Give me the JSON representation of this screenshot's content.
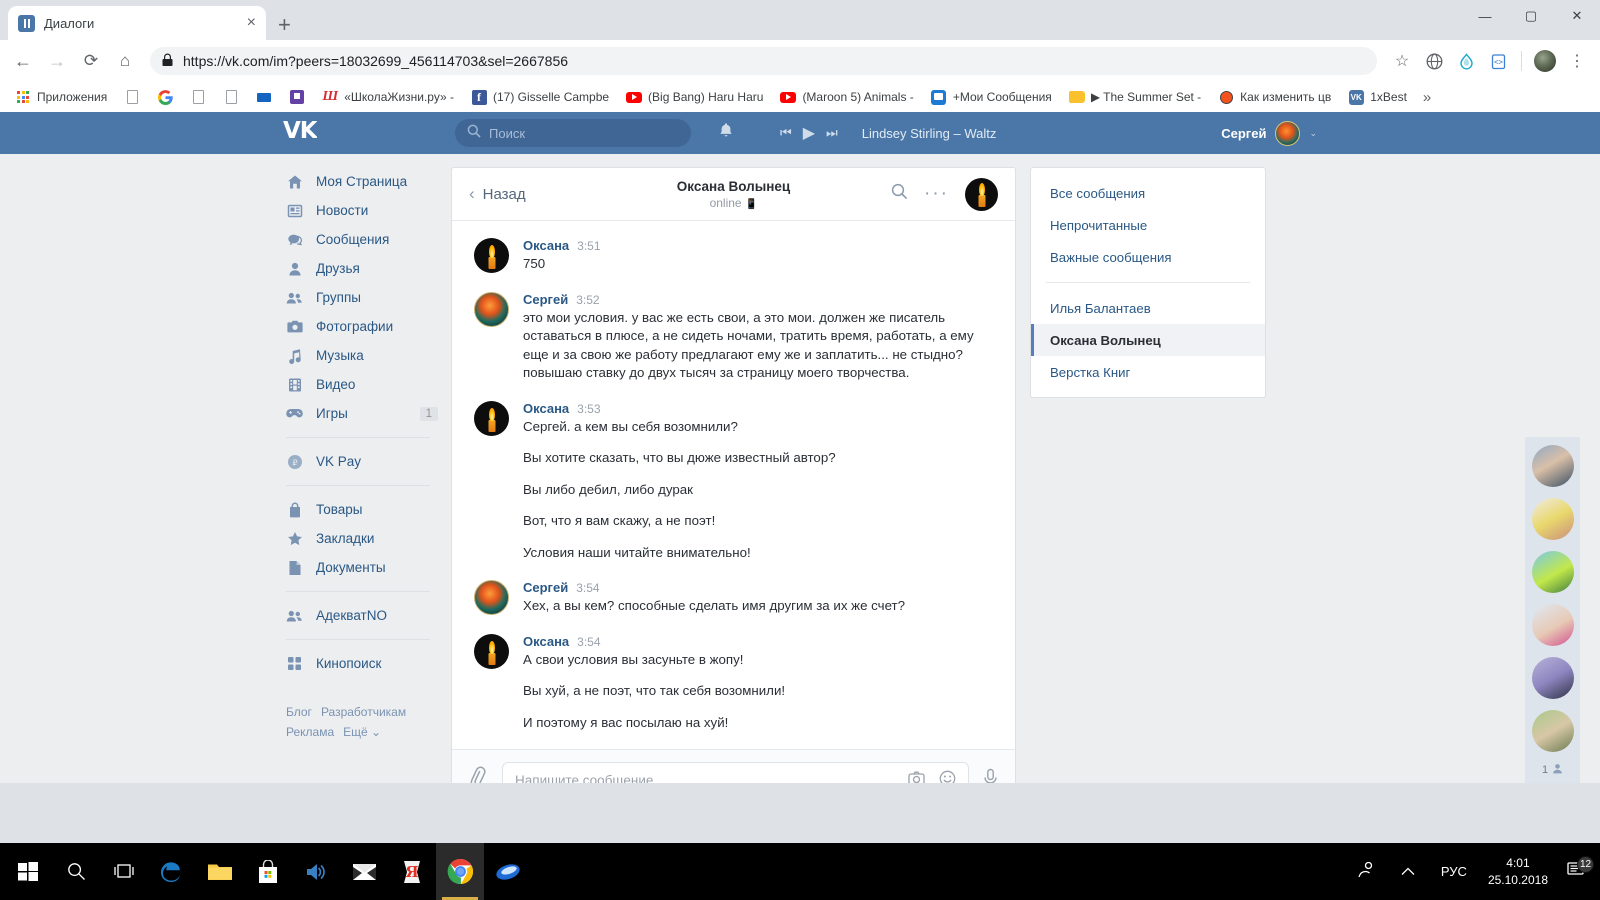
{
  "browser": {
    "tab": {
      "title": "Диалоги",
      "favicon": "vk-favicon",
      "close": "×"
    },
    "newtab_label": "+",
    "window_controls": {
      "minimize": "—",
      "maximize": "▢",
      "close": "✕"
    },
    "nav": {
      "back": "←",
      "forward": "→",
      "reload": "⟳",
      "home": "⌂"
    },
    "omnibox": {
      "lock": "🔒",
      "url": "https://vk.com/im?peers=18032699_456114703&sel=2667856",
      "star": "☆"
    },
    "toolbar_icons": [
      "globe-icon",
      "droplet-icon",
      "code-script-icon",
      "browser-profile-avatar",
      "chrome-menu-icon"
    ],
    "bookmarks": [
      {
        "label": "Приложения",
        "icon": "apps-grid-icon"
      },
      {
        "label": "",
        "icon": "doc-icon"
      },
      {
        "label": "",
        "icon": "google-icon"
      },
      {
        "label": "",
        "icon": "doc-icon"
      },
      {
        "label": "",
        "icon": "doc-icon"
      },
      {
        "label": "",
        "icon": "bars-icon"
      },
      {
        "label": "",
        "icon": "twitch-icon"
      },
      {
        "label": "«ШколаЖизни.ру» -",
        "icon": "shkola-icon"
      },
      {
        "label": "(17) Gisselle Campbe",
        "icon": "facebook-icon"
      },
      {
        "label": "(Big Bang) Haru Haru",
        "icon": "youtube-icon"
      },
      {
        "label": "(Maroon 5) Animals -",
        "icon": "youtube-icon"
      },
      {
        "label": "+Мои Сообщения",
        "icon": "messages-icon"
      },
      {
        "label": "▶ The Summer Set -",
        "icon": "folder-icon"
      },
      {
        "label": "Как изменить цв",
        "icon": "orange-circle-icon"
      },
      {
        "label": "1xBest",
        "icon": "vk-icon"
      }
    ],
    "bookmarks_overflow": "»"
  },
  "vk": {
    "logo": "VK",
    "search": {
      "placeholder": "Поиск",
      "icon": "search-icon"
    },
    "notifications_icon": "bell-icon",
    "player": {
      "prev": "⏮",
      "play": "▶",
      "next": "⏭",
      "track": "Lindsey Stirling – Waltz"
    },
    "user": {
      "name": "Сергей",
      "caret": "⌄"
    },
    "sidebar": {
      "items": [
        {
          "label": "Моя Страница",
          "icon": "home-icon",
          "badge": ""
        },
        {
          "label": "Новости",
          "icon": "news-icon",
          "badge": ""
        },
        {
          "label": "Сообщения",
          "icon": "messages-icon",
          "badge": ""
        },
        {
          "label": "Друзья",
          "icon": "friend-icon",
          "badge": ""
        },
        {
          "label": "Группы",
          "icon": "groups-icon",
          "badge": ""
        },
        {
          "label": "Фотографии",
          "icon": "camera-icon",
          "badge": ""
        },
        {
          "label": "Музыка",
          "icon": "music-note-icon",
          "badge": ""
        },
        {
          "label": "Видео",
          "icon": "film-icon",
          "badge": ""
        },
        {
          "label": "Игры",
          "icon": "gamepad-icon",
          "badge": "1"
        }
      ],
      "items2": [
        {
          "label": "VK Pay",
          "icon": "vkpay-icon"
        }
      ],
      "items3": [
        {
          "label": "Товары",
          "icon": "bag-icon"
        },
        {
          "label": "Закладки",
          "icon": "star-icon"
        },
        {
          "label": "Документы",
          "icon": "document-icon"
        }
      ],
      "items4": [
        {
          "label": "АдекватNO",
          "icon": "groups-icon"
        }
      ],
      "items5": [
        {
          "label": "Кинопоиск",
          "icon": "grid-icon"
        }
      ],
      "footer": [
        "Блог",
        "Разработчикам",
        "Реклама",
        "Ещё ⌄"
      ]
    },
    "chat": {
      "back_label": "Назад",
      "back_icon": "chevron-left-icon",
      "title": "Оксана Волынец",
      "status": "online",
      "status_device_icon": "mobile-icon",
      "search_icon": "search-icon",
      "more_icon": "ellipsis-icon",
      "avatar": "candle-avatar",
      "messages": [
        {
          "author": "Оксана",
          "time": "3:51",
          "avatar": "candle-avatar",
          "lines": [
            "750"
          ]
        },
        {
          "author": "Сергей",
          "time": "3:52",
          "avatar": "sergey-avatar",
          "lines": [
            "это мои условия. у вас же есть свои, а это мои. должен же писатель оставаться в плюсе, а не сидеть ночами, тратить время, работать, а ему еще и за свою же работу предлагают ему же и заплатить... не стыдно? повышаю ставку до двух тысяч за страницу моего творчества."
          ]
        },
        {
          "author": "Оксана",
          "time": "3:53",
          "avatar": "candle-avatar",
          "lines": [
            "Сергей. а кем вы себя возомнили?",
            "Вы хотите сказать, что вы дюже известный автор?",
            "Вы либо дебил, либо дурак",
            "Вот, что я вам скажу, а не поэт!",
            "Условия наши читайте внимательно!"
          ]
        },
        {
          "author": "Сергей",
          "time": "3:54",
          "avatar": "sergey-avatar",
          "lines": [
            "Хех, а вы кем? способные сделать имя другим за их же счет?"
          ]
        },
        {
          "author": "Оксана",
          "time": "3:54",
          "avatar": "candle-avatar",
          "lines": [
            "А свои условия вы засуньте в жопу!",
            "Вы хуй, а не поэт, что так себя возомнили!",
            "И поэтому я вас посылаю на хуй!"
          ]
        }
      ],
      "input": {
        "attach_icon": "paperclip-icon",
        "placeholder": "Напишите сообщение...",
        "camera_icon": "camera-icon",
        "emoji_icon": "smiley-icon",
        "mic_icon": "microphone-icon"
      }
    },
    "right_panel": {
      "filters": [
        "Все сообщения",
        "Непрочитанные",
        "Важные сообщения"
      ],
      "conversations": [
        {
          "name": "Илья Балантаев",
          "active": false
        },
        {
          "name": "Оксана Волынец",
          "active": true
        },
        {
          "name": "Верстка Книг",
          "active": false
        }
      ]
    },
    "photo_strip": {
      "count": "1",
      "icon": "person-icon",
      "items": 6
    }
  },
  "taskbar": {
    "items": [
      {
        "icon": "windows-start-icon",
        "active": false
      },
      {
        "icon": "search-icon",
        "active": false
      },
      {
        "icon": "task-view-icon",
        "active": false
      },
      {
        "icon": "edge-icon",
        "active": false
      },
      {
        "icon": "file-explorer-icon",
        "active": false
      },
      {
        "icon": "microsoft-store-icon",
        "active": false
      },
      {
        "icon": "speaker-app-icon",
        "active": false
      },
      {
        "icon": "mail-icon",
        "active": false
      },
      {
        "icon": "yandex-icon",
        "active": false
      },
      {
        "icon": "chrome-icon",
        "active": true
      },
      {
        "icon": "opera-icon",
        "active": false
      }
    ],
    "tray": {
      "people_icon": "people-icon",
      "chevron_icon": "chevron-up-icon",
      "language": "РУС",
      "time": "4:01",
      "date": "25.10.2018",
      "action_center_icon": "action-center-icon",
      "action_center_badge": "12"
    }
  }
}
